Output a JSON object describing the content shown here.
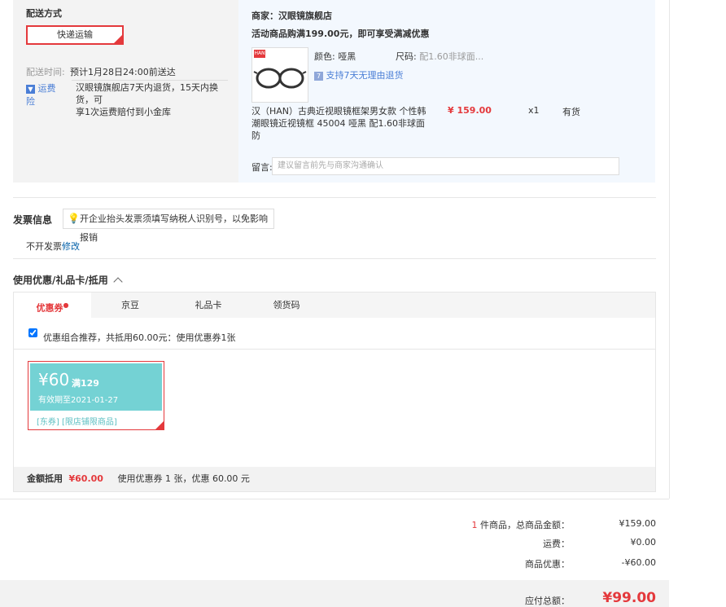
{
  "shipping": {
    "title": "配送方式",
    "method_button": "快递运输",
    "time_label": "配送时间:",
    "time_value": "预计1月28日24:00前送达",
    "insurance_label": "运费险",
    "insurance_text_1": "汉眼镜旗舰店7天内退货，15天内换货，可",
    "insurance_text_2": "享1次运费赔付到小金库"
  },
  "goods": {
    "store": "商家：汉眼镜旗舰店",
    "promo": "活动商品购满199.00元，即可享受满减优惠",
    "brand_tag": "HAN",
    "color_label": "颜色:",
    "color_value": "哑黑",
    "size_label": "尺码:",
    "size_value": "配1.60非球面...",
    "return_badge": "支持7天无理由退货",
    "name_line1": "汉（HAN）古典近视眼镜框架男女款 个性韩",
    "name_line2": "潮眼镜近视镜框 45004 哑黑 配1.60非球面防",
    "price": "¥ 159.00",
    "qty": "x1",
    "stock": "有货",
    "message_label": "留言:",
    "message_placeholder": "建议留言前先与商家沟通确认"
  },
  "invoice": {
    "title": "发票信息",
    "tip": "开企业抬头发票须填写纳税人识别号，以免影响报销",
    "status": "不开发票",
    "edit_link": "修改"
  },
  "coupons": {
    "title": "使用优惠/礼品卡/抵用",
    "tabs": [
      "优惠券",
      "京豆",
      "礼品卡",
      "领货码"
    ],
    "combo_text": "优惠组合推荐，共抵用60.00元：使用优惠券1张",
    "coupon": {
      "amount": "¥60",
      "condition": "满129",
      "expiry": "有效期至2021-01-27",
      "tags": "[东券] [限店铺限商品]"
    },
    "summary_label": "金额抵用",
    "summary_amount": "¥60.00",
    "summary_text": "使用优惠券 1 张，优惠 60.00 元"
  },
  "totals": {
    "count": "1",
    "goods_label": "件商品，总商品金额：",
    "goods_value": "¥159.00",
    "freight_label": "运费：",
    "freight_value": "¥0.00",
    "discount_label": "商品优惠：",
    "discount_value": "-¥60.00",
    "payable_label": "应付总额：",
    "payable_value": "¥99.00"
  },
  "colors": {
    "accent": "#e4393c",
    "coupon": "#74d2d4",
    "link": "#005ea7"
  }
}
